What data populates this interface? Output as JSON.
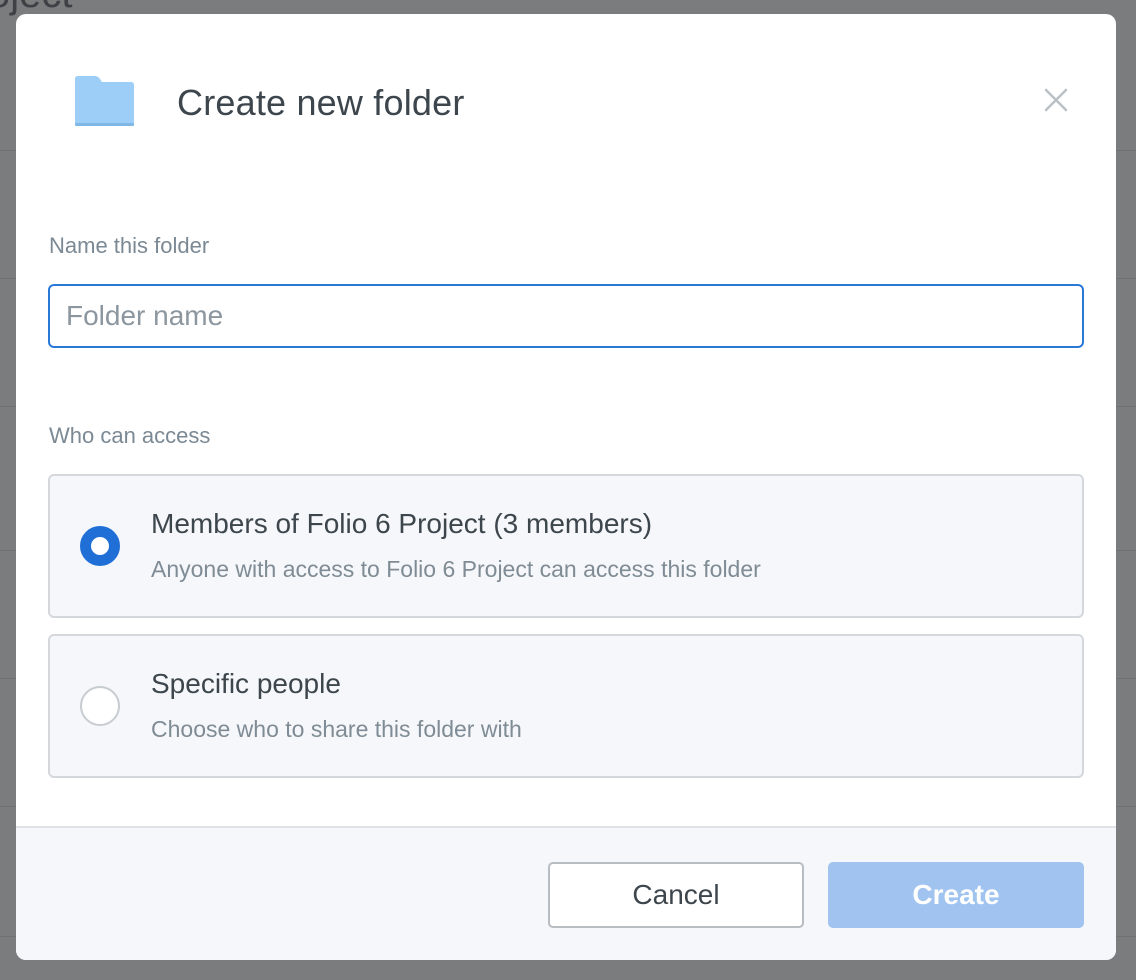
{
  "background": {
    "title_fragment": "oject"
  },
  "modal": {
    "title": "Create new folder",
    "folder_icon": "folder-icon",
    "close_icon": "close-icon",
    "close_glyph": "✕"
  },
  "name_field": {
    "label": "Name this folder",
    "placeholder": "Folder name",
    "value": ""
  },
  "access": {
    "label": "Who can access",
    "options": [
      {
        "title": "Members of Folio 6 Project (3 members)",
        "description": "Anyone with access to Folio 6 Project can access this folder",
        "selected": true
      },
      {
        "title": "Specific people",
        "description": "Choose who to share this folder with",
        "selected": false
      }
    ]
  },
  "footer": {
    "cancel_label": "Cancel",
    "create_label": "Create"
  },
  "colors": {
    "accent": "#1f6fd6",
    "input_border": "#2a79d7",
    "create_disabled": "#a0c4ef",
    "folder": "#9dcef8"
  }
}
